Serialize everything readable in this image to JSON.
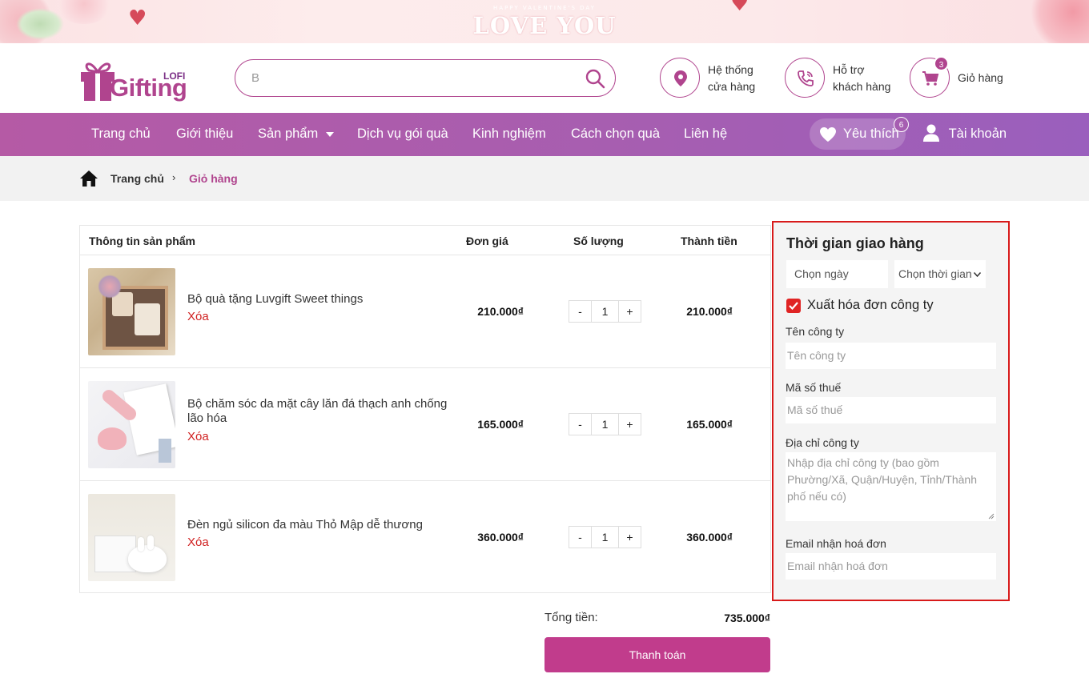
{
  "banner": {
    "subtitle": "HAPPY VALENTINE'S DAY",
    "title": "LOVE YOU"
  },
  "header": {
    "logo_small": "LOFI",
    "logo_main": "Gifting",
    "search_value": "B",
    "store": {
      "line1": "Hệ thống",
      "line2": "cửa hàng"
    },
    "support": {
      "line1": "Hỗ trợ",
      "line2": "khách hàng"
    },
    "cart": {
      "label": "Giỏ hàng",
      "count": "3"
    }
  },
  "nav": {
    "items": [
      "Trang chủ",
      "Giới thiệu",
      "Sản phẩm",
      "Dịch vụ gói quà",
      "Kinh nghiệm",
      "Cách chọn quà",
      "Liên hệ"
    ],
    "wishlist": {
      "label": "Yêu thích",
      "count": "6"
    },
    "account": "Tài khoản"
  },
  "breadcrumb": {
    "home": "Trang chủ",
    "separator": "›",
    "current": "Giỏ hàng"
  },
  "cart_table": {
    "headers": [
      "Thông tin sản phẩm",
      "Đơn giá",
      "Số lượng",
      "Thành tiền"
    ],
    "delete_label": "Xóa",
    "minus": "-",
    "plus": "+",
    "rows": [
      {
        "name": "Bộ quà tặng Luvgift Sweet things",
        "price": "210.000₫",
        "qty": "1",
        "total": "210.000₫"
      },
      {
        "name": "Bộ chăm sóc da mặt cây lăn đá thạch anh chống lão hóa",
        "price": "165.000₫",
        "qty": "1",
        "total": "165.000₫"
      },
      {
        "name": "Đèn ngủ silicon đa màu Thỏ Mập dễ thương",
        "price": "360.000₫",
        "qty": "1",
        "total": "360.000₫"
      }
    ],
    "sum_label": "Tổng tiền:",
    "sum_value": "735.000₫",
    "pay_label": "Thanh toán"
  },
  "delivery": {
    "title": "Thời gian giao hàng",
    "date_placeholder": "Chọn ngày",
    "time_select": "Chọn thời gian",
    "invoice_label": "Xuất hóa đơn công ty",
    "company_label": "Tên công ty",
    "company_placeholder": "Tên công ty",
    "tax_label": "Mã số thuế",
    "tax_placeholder": "Mã số thuế",
    "address_label": "Địa chỉ công ty",
    "address_placeholder": "Nhập địa chỉ công ty (bao gồm Phường/Xã, Quận/Huyện, Tỉnh/Thành phố nếu có)",
    "email_label": "Email nhận hoá đơn",
    "email_placeholder": "Email nhận hoá đơn"
  },
  "colors": {
    "brand": "#b0448e",
    "nav": "#a65eb1",
    "pay": "#c13c8c",
    "highlight_border": "#d81a1a"
  }
}
